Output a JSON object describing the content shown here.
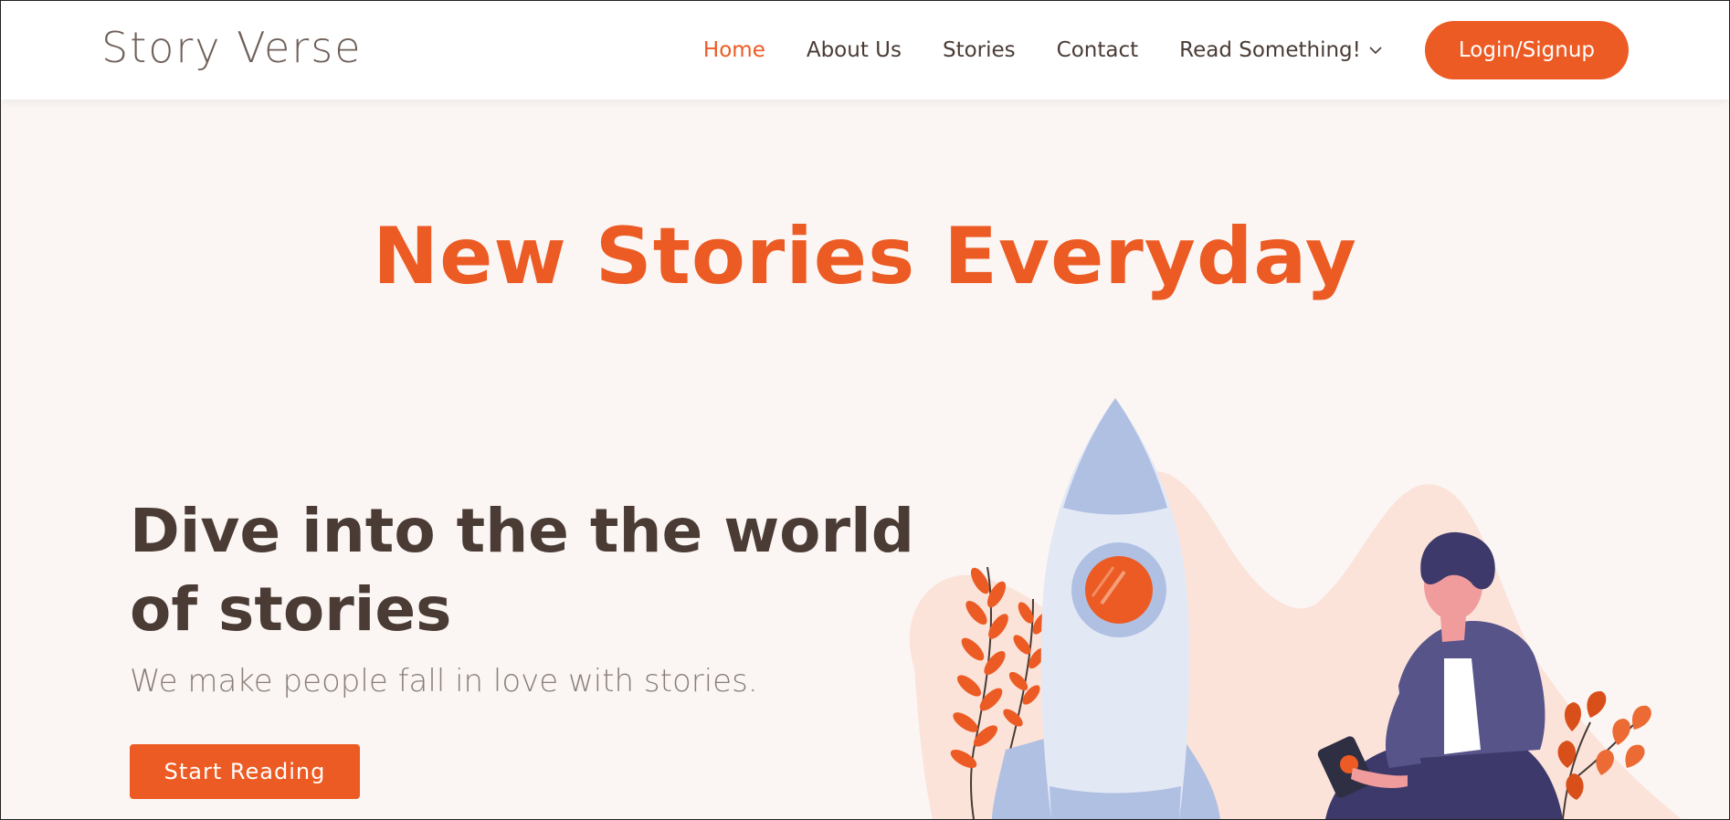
{
  "header": {
    "brand": "Story Verse",
    "nav": {
      "home": "Home",
      "about": "About Us",
      "stories": "Stories",
      "contact": "Contact",
      "read": "Read Something!"
    },
    "login": "Login/Signup"
  },
  "hero": {
    "title": "New Stories Everyday",
    "headline_line1": "Dive into the the world",
    "headline_line2": "of stories",
    "subline": "We make people fall in love with stories.",
    "cta": "Start Reading"
  },
  "colors": {
    "accent": "#ec5b24",
    "dark_text": "#4a3b35",
    "muted_text": "#8a7d78",
    "background": "#fbf6f3"
  },
  "icons": {
    "read_dropdown": "chevron-down-icon"
  }
}
